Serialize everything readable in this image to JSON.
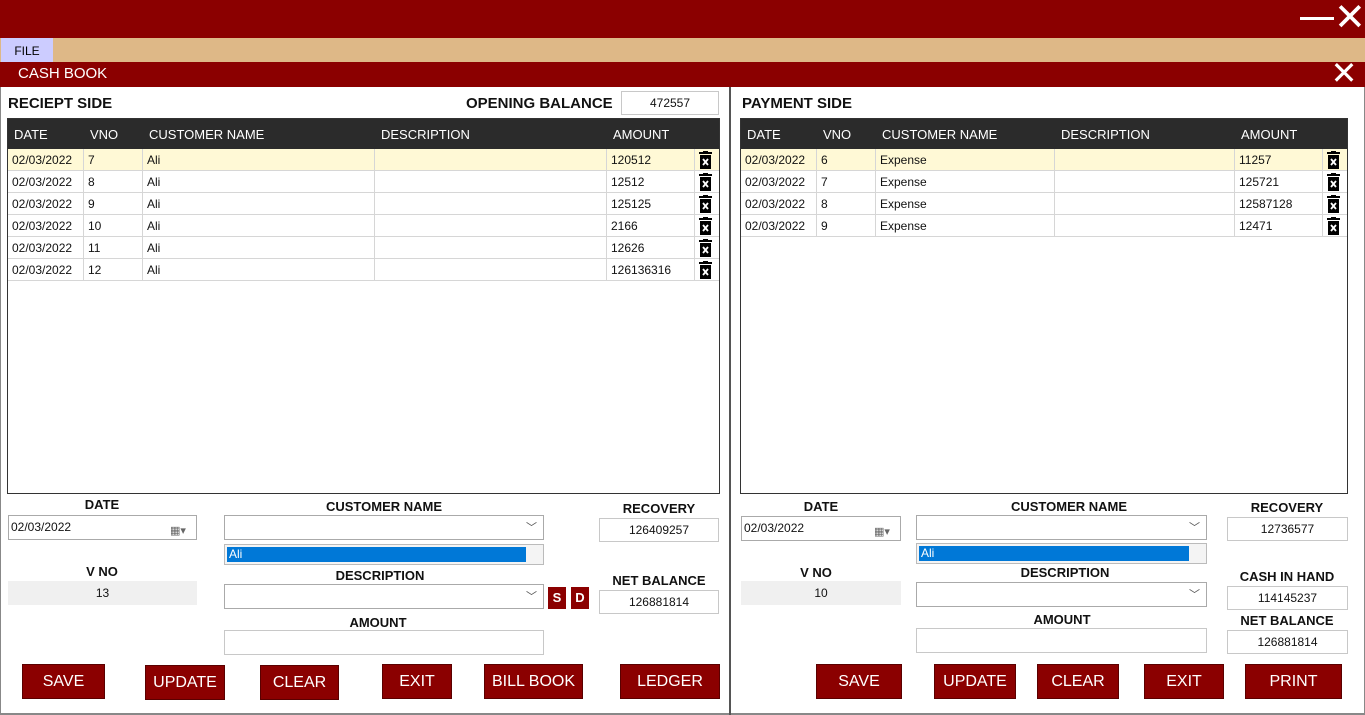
{
  "window": {
    "close_glyph": "✕",
    "minimize_glyph": "—"
  },
  "menu": {
    "file": "FILE"
  },
  "form": {
    "title": "CASH BOOK",
    "close_glyph": "✕"
  },
  "receipt": {
    "title": "RECIEPT SIDE",
    "opening_label": "OPENING BALANCE",
    "opening_value": "472557",
    "columns": [
      "DATE",
      "VNO",
      "CUSTOMER NAME",
      "DESCRIPTION",
      "AMOUNT"
    ],
    "rows": [
      [
        "02/03/2022",
        "7",
        "Ali",
        "",
        "120512"
      ],
      [
        "02/03/2022",
        "8",
        "Ali",
        "",
        "12512"
      ],
      [
        "02/03/2022",
        "9",
        "Ali",
        "",
        "125125"
      ],
      [
        "02/03/2022",
        "10",
        "Ali",
        "",
        "2166"
      ],
      [
        "02/03/2022",
        "11",
        "Ali",
        "",
        "12626"
      ],
      [
        "02/03/2022",
        "12",
        "Ali",
        "",
        "126136316"
      ]
    ],
    "date_label": "DATE",
    "date_value": "02/03/2022",
    "vno_label": "V NO",
    "vno_value": "13",
    "customer_label": "CUSTOMER NAME",
    "customer_selected": "Ali",
    "description_label": "DESCRIPTION",
    "s_label": "S",
    "d_label": "D",
    "amount_label": "AMOUNT",
    "recovery_label": "RECOVERY",
    "recovery_value": "126409257",
    "net_label": "NET BALANCE",
    "net_value": "126881814",
    "buttons": {
      "save": "SAVE",
      "update": "UPDATE",
      "clear": "CLEAR",
      "exit": "EXIT",
      "bill_book": "BILL BOOK",
      "ledger": "LEDGER"
    }
  },
  "payment": {
    "title": "PAYMENT SIDE",
    "columns": [
      "DATE",
      "VNO",
      "CUSTOMER NAME",
      "DESCRIPTION",
      "AMOUNT"
    ],
    "rows": [
      [
        "02/03/2022",
        "6",
        "Expense",
        "",
        "11257"
      ],
      [
        "02/03/2022",
        "7",
        "Expense",
        "",
        "125721"
      ],
      [
        "02/03/2022",
        "8",
        "Expense",
        "",
        "12587128"
      ],
      [
        "02/03/2022",
        "9",
        "Expense",
        "",
        "12471"
      ]
    ],
    "date_label": "DATE",
    "date_value": "02/03/2022",
    "vno_label": "V NO",
    "vno_value": "10",
    "customer_label": "CUSTOMER NAME",
    "customer_selected": "Ali",
    "description_label": "DESCRIPTION",
    "amount_label": "AMOUNT",
    "recovery_label": "RECOVERY",
    "recovery_value": "12736577",
    "cash_label": "CASH IN HAND",
    "cash_value": "114145237",
    "net_label": "NET BALANCE",
    "net_value": "126881814",
    "buttons": {
      "save": "SAVE",
      "update": "UPDATE",
      "clear": "CLEAR",
      "exit": "EXIT",
      "print": "PRINT"
    }
  },
  "icons": {
    "row_delete": "trash-icon",
    "calendar": "calendar-icon",
    "dropdown": "chevron-down-icon"
  },
  "colors": {
    "brand": "#8b0000",
    "menubar": "#deb887",
    "grid_header": "#2b2b2b",
    "selected_row": "#fff9d6",
    "list_selection": "#0078d7"
  }
}
